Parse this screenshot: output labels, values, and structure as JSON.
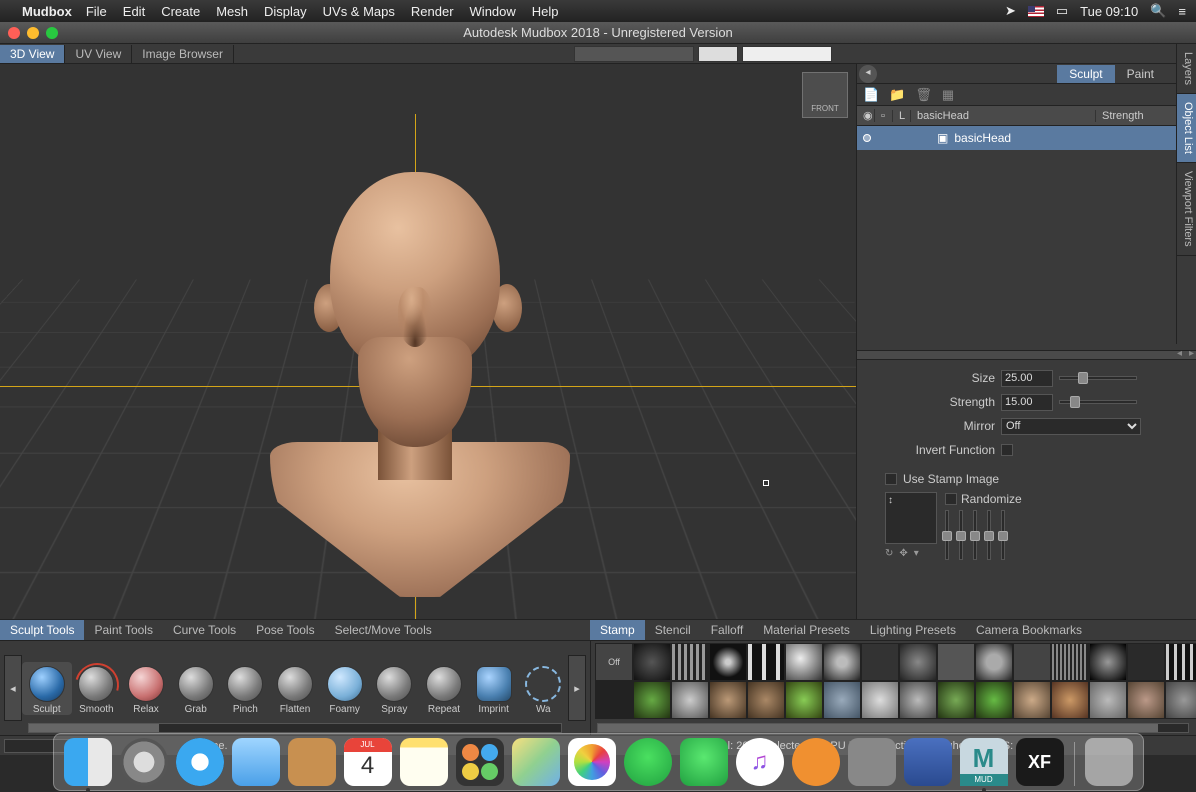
{
  "menubar": {
    "app": "Mudbox",
    "items": [
      "File",
      "Edit",
      "Create",
      "Mesh",
      "Display",
      "UVs & Maps",
      "Render",
      "Window",
      "Help"
    ],
    "clock": "Tue 09:10"
  },
  "window_title": "Autodesk Mudbox 2018 - Unregistered Version",
  "view_tabs": [
    "3D View",
    "UV View",
    "Image Browser"
  ],
  "viewcube": "FRONT",
  "vtabs": [
    "Layers",
    "Object List",
    "Viewport Filters"
  ],
  "right": {
    "tabs": [
      "Sculpt",
      "Paint"
    ],
    "cols": {
      "L": "L",
      "name": "basicHead",
      "strength": "Strength"
    },
    "row": "basicHead"
  },
  "props": {
    "size_label": "Size",
    "size": "25.00",
    "strength_label": "Strength",
    "strength": "15.00",
    "mirror_label": "Mirror",
    "mirror": "Off",
    "invert_label": "Invert Function",
    "stamp_label": "Use Stamp Image",
    "randomize_label": "Randomize"
  },
  "bottom_tabs_left": [
    "Sculpt Tools",
    "Paint Tools",
    "Curve Tools",
    "Pose Tools",
    "Select/Move Tools"
  ],
  "bottom_tabs_right": [
    "Stamp",
    "Stencil",
    "Falloff",
    "Material Presets",
    "Lighting Presets",
    "Camera Bookmarks"
  ],
  "tools": [
    "Sculpt",
    "Smooth",
    "Relax",
    "Grab",
    "Pinch",
    "Flatten",
    "Foamy",
    "Spray",
    "Repeat",
    "Imprint",
    "Wa"
  ],
  "stamp_off": "Off",
  "status": {
    "done": "done.",
    "stats": "Total: 2002  Selected: 0 GPU Mem: 0  Active: 0, Highest: 0  FPS: 17.0838"
  },
  "cal_day": "4"
}
